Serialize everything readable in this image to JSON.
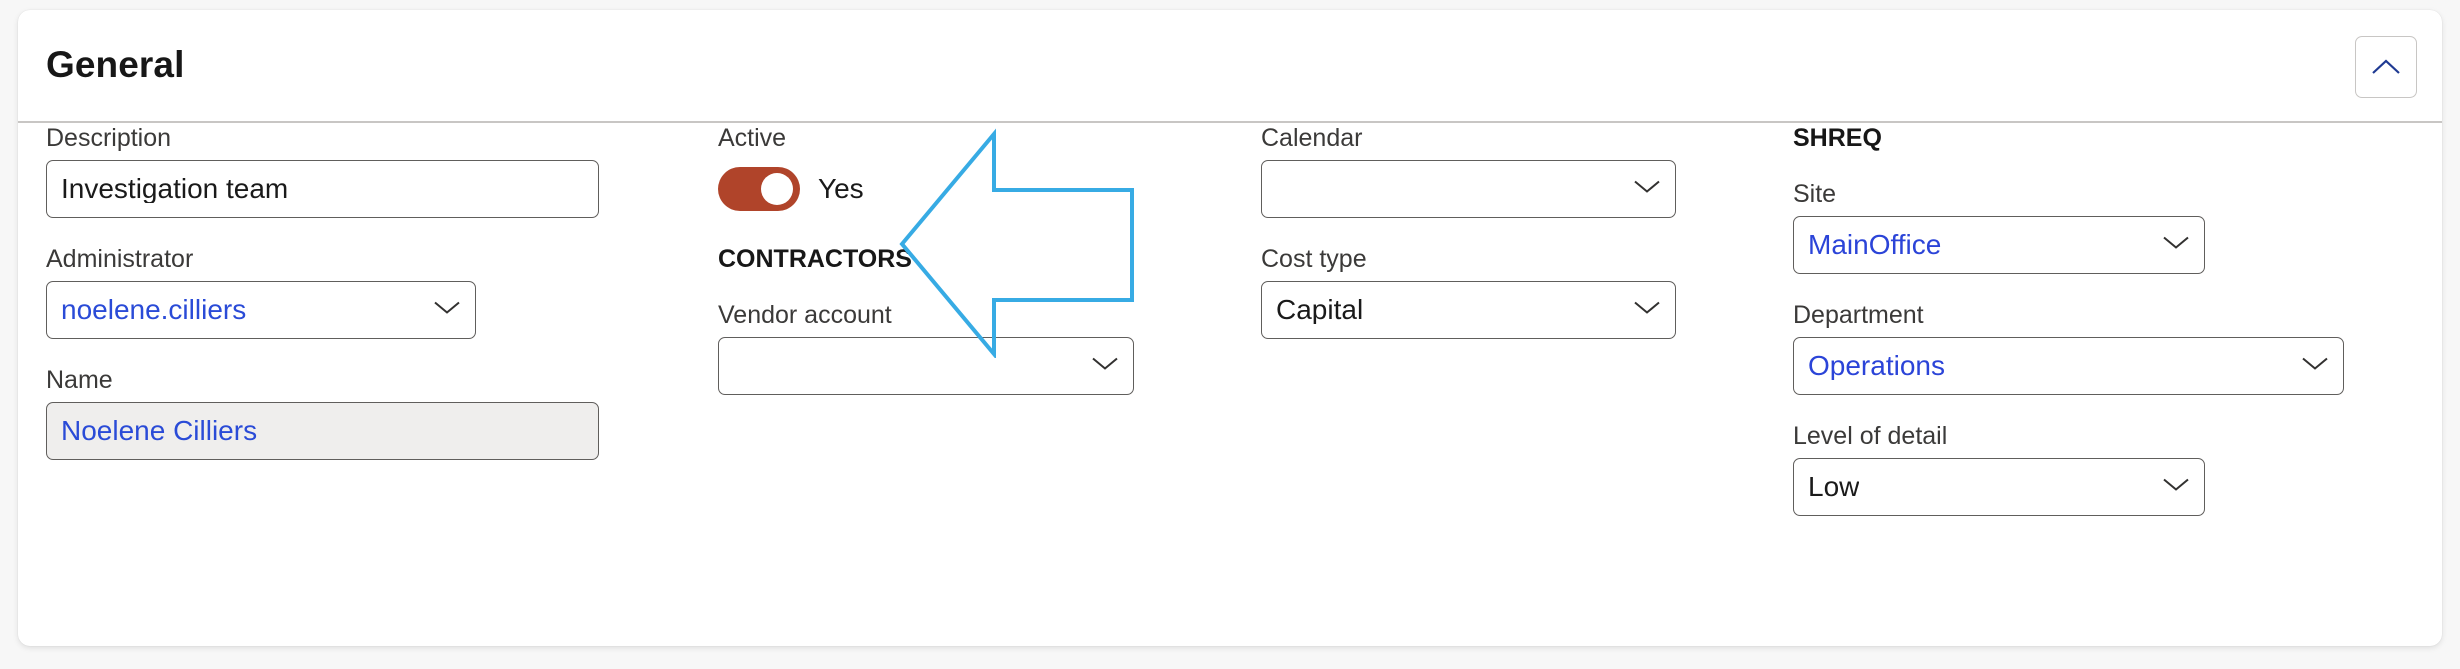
{
  "panel": {
    "title": "General",
    "collapse_icon": "chevron-up-icon"
  },
  "columns": {
    "column_1": {
      "fields": [
        {
          "label": "Description",
          "type": "text",
          "value": "Investigation team",
          "readonly": false,
          "value_style": "plain"
        },
        {
          "label": "Administrator",
          "type": "dropdown",
          "value": "noelene.cilliers",
          "readonly": false,
          "value_style": "link",
          "icon": "chevron-down-icon"
        },
        {
          "label": "Name",
          "type": "text",
          "value": "Noelene Cilliers",
          "readonly": true,
          "value_style": "link"
        }
      ]
    },
    "column_2": {
      "active": {
        "label": "Active",
        "toggle_state": "on",
        "toggle_text": "Yes",
        "toggle_color": "#b0442a"
      },
      "group_title": "CONTRACTORS",
      "fields": [
        {
          "label": "Vendor account",
          "type": "dropdown",
          "value": "",
          "readonly": false,
          "value_style": "plain",
          "icon": "chevron-down-icon"
        }
      ]
    },
    "column_3": {
      "fields": [
        {
          "label": "Calendar",
          "type": "dropdown",
          "value": "",
          "readonly": false,
          "value_style": "plain",
          "icon": "chevron-down-icon"
        },
        {
          "label": "Cost type",
          "type": "dropdown",
          "value": "Capital",
          "readonly": false,
          "value_style": "plain",
          "icon": "chevron-down-icon"
        }
      ]
    },
    "column_4": {
      "group_title": "SHREQ",
      "fields": [
        {
          "label": "Site",
          "type": "dropdown",
          "value": "MainOffice",
          "readonly": false,
          "value_style": "link",
          "icon": "chevron-down-icon"
        },
        {
          "label": "Department",
          "type": "dropdown",
          "value": "Operations",
          "readonly": false,
          "value_style": "link",
          "icon": "chevron-down-icon"
        },
        {
          "label": "Level of detail",
          "type": "dropdown",
          "value": "Low",
          "readonly": false,
          "value_style": "plain",
          "icon": "chevron-down-icon"
        }
      ]
    }
  },
  "annotation": {
    "shape": "left-arrow-annotation",
    "color": "#37abe4",
    "points_to": "Active toggle"
  },
  "colors": {
    "page_background": "#f7f7f7",
    "card_background": "#ffffff",
    "link_text": "#2a4bd7",
    "label_text": "#3b3a39",
    "border": "#605e5c",
    "readonly_background": "#efeeed",
    "accent_toggle": "#b0442a",
    "annotation_blue": "#37abe4"
  }
}
